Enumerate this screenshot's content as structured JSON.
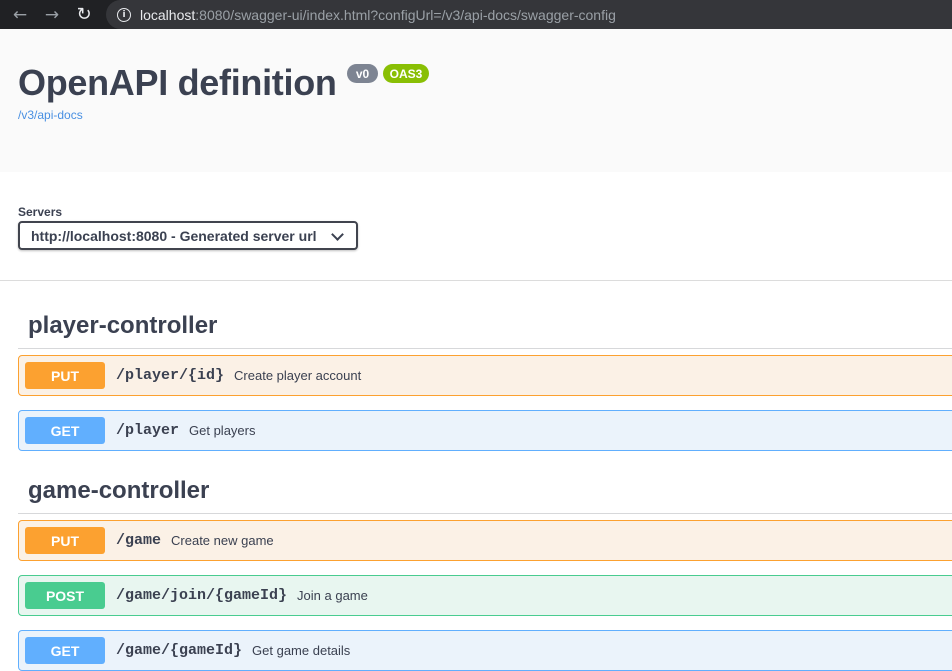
{
  "browser": {
    "back_icon": "←",
    "forward_icon": "→",
    "reload_icon": "↻",
    "info_icon": "i",
    "url_host": "localhost",
    "url_rest": ":8080/swagger-ui/index.html?configUrl=/v3/api-docs/swagger-config"
  },
  "info": {
    "title": "OpenAPI definition",
    "version": "v0",
    "oas": "OAS3",
    "spec_link": "/v3/api-docs"
  },
  "servers": {
    "label": "Servers",
    "selected": "http://localhost:8080 - Generated server url"
  },
  "tags": [
    {
      "name": "player-controller",
      "operations": [
        {
          "method": "PUT",
          "path": "/player/{id}",
          "summary": "Create player account"
        },
        {
          "method": "GET",
          "path": "/player",
          "summary": "Get players"
        }
      ]
    },
    {
      "name": "game-controller",
      "operations": [
        {
          "method": "PUT",
          "path": "/game",
          "summary": "Create new game"
        },
        {
          "method": "POST",
          "path": "/game/join/{gameId}",
          "summary": "Join a game"
        },
        {
          "method": "GET",
          "path": "/game/{gameId}",
          "summary": "Get game details"
        }
      ]
    }
  ],
  "colors": {
    "put": "#fca130",
    "get": "#61affe",
    "post": "#49cc90",
    "oas_badge": "#89bf04",
    "version_badge": "#7d8492",
    "link": "#4990e2"
  }
}
